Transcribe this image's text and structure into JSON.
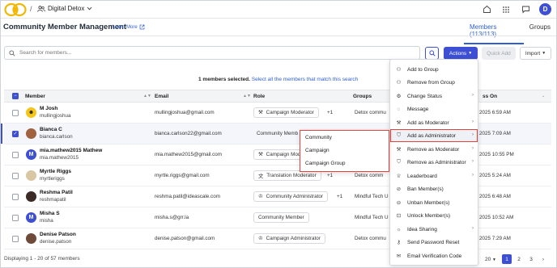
{
  "topbar": {
    "workspace": "Digital Detox",
    "user_initial": "D"
  },
  "header": {
    "title": "Community Member Management",
    "learn_more": "Learn More",
    "tabs": [
      {
        "label": "Members (113/113)",
        "active": true
      },
      {
        "label": "Groups",
        "active": false
      }
    ]
  },
  "toolbar": {
    "search_placeholder": "Search for members...",
    "actions_label": "Actions",
    "quick_add_label": "Quick Add",
    "import_label": "Import"
  },
  "selection": {
    "count_text": "1 members selected.",
    "select_all_text": "Select all the members that match this search"
  },
  "table": {
    "headers": {
      "member": "Member",
      "email": "Email",
      "role": "Role",
      "groups": "Groups",
      "last": "ss On"
    },
    "rows": [
      {
        "name": "M Josh",
        "username": "mullingjoshua",
        "email": "mullingjoshua@gmail.com",
        "role": "Campaign Moderator",
        "role_icon": "gavel-icon",
        "extra": "+1",
        "groups": "Detox commu",
        "last": "2025 6:59 AM",
        "avatar": "photo",
        "selected": false
      },
      {
        "name": "Bianca C",
        "username": "bianca.carlson",
        "email": "bianca.carlson22@gmail.com",
        "role": "Community Memb",
        "role_icon": "",
        "extra": "",
        "groups": "",
        "last": "2025 7:09 AM",
        "avatar": "photo",
        "selected": true
      },
      {
        "name": "mia.mathew2015 Mathew",
        "username": "mia.mathew2015",
        "email": "mia.mathew2015@gmail.com",
        "role": "Campaign Mod",
        "role_icon": "gavel-icon",
        "extra": "",
        "groups": "",
        "last": "2025 10:55 PM",
        "avatar": "M",
        "selected": false
      },
      {
        "name": "Myrtle Riggs",
        "username": "myrtleriggs",
        "email": "myrtle.riggs@gmail.com",
        "role": "Translation Moderator",
        "role_icon": "translate-icon",
        "extra": "+1",
        "groups": "Detox comm",
        "last": "2025 5:24 AM",
        "avatar": "photo",
        "selected": false
      },
      {
        "name": "Reshma Patil",
        "username": "reshmapatil",
        "email": "reshma.patil@ideascale.com",
        "role": "Community Administrator",
        "role_icon": "crown-icon",
        "extra": "+1",
        "groups": "Mindful Tech U",
        "last": "2025 6:48 AM",
        "avatar": "photo",
        "selected": false
      },
      {
        "name": "Misha S",
        "username": "misha",
        "email": "misha.s@grr.la",
        "role": "Community Member",
        "role_icon": "",
        "extra": "",
        "groups": "Mindful Tech U",
        "last": "2025 10:52 AM",
        "avatar": "M",
        "selected": false
      },
      {
        "name": "Denise Patson",
        "username": "denise.patson",
        "email": "denise.patson@gmail.com",
        "role": "Campaign Administrator",
        "role_icon": "crown-icon",
        "extra": "",
        "groups": "Detox commu",
        "last": "2025 7:29 AM",
        "avatar": "photo",
        "selected": false
      }
    ]
  },
  "footer": {
    "display_text": "Displaying 1 - 20 of 57 members",
    "per_page": "20",
    "pages": [
      "1",
      "2",
      "3"
    ],
    "next": "›"
  },
  "actions_menu": [
    {
      "label": "Add to Group",
      "icon": "user-plus-icon",
      "submenu": false
    },
    {
      "label": "Remove from Group",
      "icon": "user-minus-icon",
      "submenu": false
    },
    {
      "label": "Change Status",
      "icon": "status-icon",
      "submenu": true
    },
    {
      "label": "Message",
      "icon": "message-icon",
      "submenu": false
    },
    {
      "label": "Add as Moderator",
      "icon": "gavel-icon",
      "submenu": true
    },
    {
      "label": "Add as Administrator",
      "icon": "shield-icon",
      "submenu": true,
      "highlighted": true
    },
    {
      "label": "Remove as Moderator",
      "icon": "gavel-icon",
      "submenu": true
    },
    {
      "label": "Remove as Administrator",
      "icon": "shield-icon",
      "submenu": true
    },
    {
      "label": "Leaderboard",
      "icon": "trophy-icon",
      "submenu": true
    },
    {
      "label": "Ban Member(s)",
      "icon": "ban-icon",
      "submenu": false
    },
    {
      "label": "Unban Member(s)",
      "icon": "unban-icon",
      "submenu": false
    },
    {
      "label": "Unlock Member(s)",
      "icon": "unlock-icon",
      "submenu": false
    },
    {
      "label": "Idea Sharing",
      "icon": "idea-icon",
      "submenu": true
    },
    {
      "label": "Send Password Reset",
      "icon": "key-icon",
      "submenu": false
    },
    {
      "label": "Email Verification Code",
      "icon": "mail-icon",
      "submenu": false
    }
  ],
  "admin_submenu": [
    "Community",
    "Campaign",
    "Campaign Group"
  ],
  "colors": {
    "primary": "#3d4fd3",
    "highlight": "#e3423b"
  }
}
